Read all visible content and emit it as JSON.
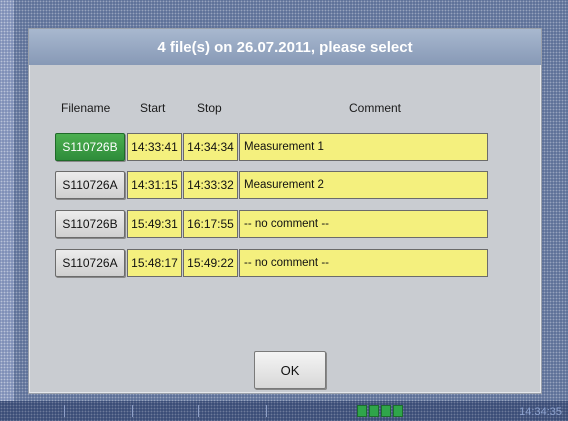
{
  "dialog": {
    "title": "4 file(s) on 26.07.2011, please select",
    "columns": {
      "filename": "Filename",
      "start": "Start",
      "stop": "Stop",
      "comment": "Comment"
    },
    "rows": [
      {
        "filename": "S110726B",
        "start": "14:33:41",
        "stop": "14:34:34",
        "comment": "Measurement 1",
        "selected": true
      },
      {
        "filename": "S110726A",
        "start": "14:31:15",
        "stop": "14:33:32",
        "comment": "Measurement  2",
        "selected": false
      },
      {
        "filename": "S110726B",
        "start": "15:49:31",
        "stop": "16:17:55",
        "comment": "-- no comment --",
        "selected": false
      },
      {
        "filename": "S110726A",
        "start": "15:48:17",
        "stop": "15:49:22",
        "comment": "-- no comment --",
        "selected": false
      }
    ],
    "ok_label": "OK"
  },
  "background": {
    "time": "14:34:35"
  },
  "colors": {
    "selected": "#3a9e45",
    "cell_yellow": "#f4f07e",
    "title_bar": "#97a8c3"
  }
}
